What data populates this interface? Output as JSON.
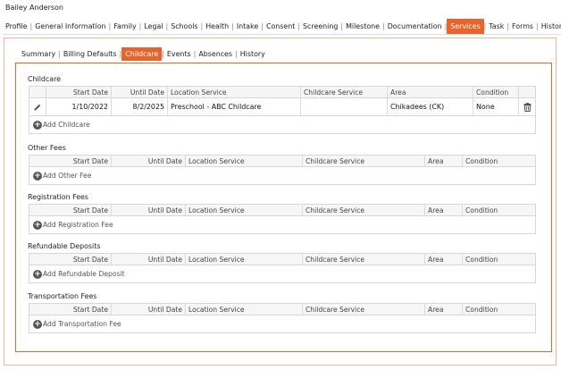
{
  "person": {
    "name": "Bailey Anderson"
  },
  "top_tabs": [
    "Profile",
    "General Information",
    "Family",
    "Legal",
    "Schools",
    "Health",
    "Intake",
    "Consent",
    "Screening",
    "Milestone",
    "Documentation",
    "Services",
    "Task",
    "Forms",
    "History"
  ],
  "top_tabs_active": "Services",
  "sub_tabs": [
    "Summary",
    "Billing Defaults",
    "Childcare",
    "Events",
    "Absences",
    "History"
  ],
  "sub_tabs_active": "Childcare",
  "childcare": {
    "title": "Childcare",
    "headers": [
      "Start Date",
      "Until Date",
      "Location Service",
      "Childcare Service",
      "Area",
      "Condition"
    ],
    "row": {
      "start_date": "1/10/2022",
      "until_date": "8/2/2025",
      "location_service": "Preschool - ABC Childcare",
      "childcare_service": "",
      "area": "Chikadees (CK)",
      "condition": "None"
    },
    "add_label": "Add Childcare"
  },
  "other_fees": {
    "title": "Other Fees",
    "headers": [
      "Start Date",
      "Until Date",
      "Location Service",
      "Childcare Service",
      "Area",
      "Condition"
    ],
    "add_label": "Add Other Fee"
  },
  "registration_fees": {
    "title": "Registration Fees",
    "headers": [
      "Start Date",
      "Until Date",
      "Location Service",
      "Childcare Service",
      "Area",
      "Condition"
    ],
    "add_label": "Add Registration Fee"
  },
  "refundable_deposits": {
    "title": "Refundable Deposits",
    "headers": [
      "Start Date",
      "Until Date",
      "Location Service",
      "Childcare Service",
      "Area",
      "Condition"
    ],
    "add_label": "Add Refundable Deposit"
  },
  "transportation_fees": {
    "title": "Transportation Fees",
    "headers": [
      "Start Date",
      "Until Date",
      "Location Service",
      "Childcare Service",
      "Area",
      "Condition"
    ],
    "add_label": "Add Transportation Fee"
  },
  "colors": {
    "accent": "#e8642c",
    "frame": "#e8b89c"
  }
}
